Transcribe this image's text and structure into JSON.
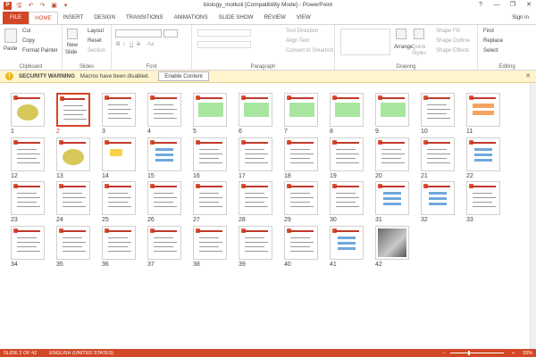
{
  "window": {
    "title": "biology_molkoli [Compatibility Mode] - PowerPoint",
    "controls": [
      "?",
      "—",
      "❐",
      "✕"
    ]
  },
  "qat": {
    "save": "🖫",
    "undo": "↶",
    "redo": "↷",
    "present": "▣",
    "customize": "▾"
  },
  "tabs": [
    "FILE",
    "HOME",
    "INSERT",
    "DESIGN",
    "TRANSITIONS",
    "ANIMATIONS",
    "SLIDE SHOW",
    "REVIEW",
    "VIEW"
  ],
  "active_tab": "HOME",
  "signin": "Sign in",
  "ribbon": {
    "clipboard": {
      "label": "Clipboard",
      "paste": "Paste",
      "cut": "Cut",
      "copy": "Copy",
      "format_painter": "Format Painter"
    },
    "slides": {
      "label": "Slides",
      "new_slide": "New",
      "new_slide2": "Slide",
      "layout": "Layout",
      "reset": "Reset",
      "section": "Section"
    },
    "font": {
      "label": "Font",
      "bold": "B",
      "italic": "I",
      "underline": "U",
      "strike": "S",
      "aa": "Aa"
    },
    "paragraph": {
      "label": "Paragraph",
      "text_direction": "Text Direction",
      "align_text": "Align Text",
      "convert": "Convert to SmartArt"
    },
    "drawing": {
      "label": "Drawing",
      "arrange": "Arrange",
      "quick_styles": "Quick Styles",
      "shape_fill": "Shape Fill",
      "shape_outline": "Shape Outline",
      "shape_effects": "Shape Effects"
    },
    "editing": {
      "label": "Editing",
      "find": "Find",
      "replace": "Replace",
      "select": "Select"
    }
  },
  "security": {
    "title": "SECURITY WARNING",
    "message": "Macros have been disabled.",
    "button": "Enable Content",
    "close": "✕"
  },
  "slides": [
    {
      "n": "1",
      "kind": "title-art"
    },
    {
      "n": "2",
      "kind": "diagram"
    },
    {
      "n": "3",
      "kind": "diagram"
    },
    {
      "n": "4",
      "kind": "diagram"
    },
    {
      "n": "5",
      "kind": "green-text"
    },
    {
      "n": "6",
      "kind": "green-text"
    },
    {
      "n": "7",
      "kind": "green-text"
    },
    {
      "n": "8",
      "kind": "green-text"
    },
    {
      "n": "9",
      "kind": "green-text"
    },
    {
      "n": "10",
      "kind": "text-bullets"
    },
    {
      "n": "11",
      "kind": "orange-boxes"
    },
    {
      "n": "12",
      "kind": "diagram"
    },
    {
      "n": "13",
      "kind": "title-art"
    },
    {
      "n": "14",
      "kind": "yellow-box"
    },
    {
      "n": "15",
      "kind": "blue-list"
    },
    {
      "n": "16",
      "kind": "diagram"
    },
    {
      "n": "17",
      "kind": "text-bullets"
    },
    {
      "n": "18",
      "kind": "diagram"
    },
    {
      "n": "19",
      "kind": "diagram"
    },
    {
      "n": "20",
      "kind": "diagram"
    },
    {
      "n": "21",
      "kind": "text-bullets"
    },
    {
      "n": "22",
      "kind": "blue-list"
    },
    {
      "n": "23",
      "kind": "text-bullets"
    },
    {
      "n": "24",
      "kind": "diagram"
    },
    {
      "n": "25",
      "kind": "text-bullets"
    },
    {
      "n": "26",
      "kind": "diagram"
    },
    {
      "n": "27",
      "kind": "diagram"
    },
    {
      "n": "28",
      "kind": "text-bullets"
    },
    {
      "n": "29",
      "kind": "diagram"
    },
    {
      "n": "30",
      "kind": "text-bullets"
    },
    {
      "n": "31",
      "kind": "blue-list"
    },
    {
      "n": "32",
      "kind": "blue-list"
    },
    {
      "n": "33",
      "kind": "text-bullets"
    },
    {
      "n": "34",
      "kind": "diagram"
    },
    {
      "n": "35",
      "kind": "diagram"
    },
    {
      "n": "36",
      "kind": "diagram"
    },
    {
      "n": "37",
      "kind": "text-bullets"
    },
    {
      "n": "38",
      "kind": "text-bullets"
    },
    {
      "n": "39",
      "kind": "diagram"
    },
    {
      "n": "40",
      "kind": "diagram"
    },
    {
      "n": "41",
      "kind": "blue-list"
    },
    {
      "n": "42",
      "kind": "photo"
    }
  ],
  "selected_slide": "2",
  "status": {
    "slide": "SLIDE 2 OF 42",
    "language": "ENGLISH (UNITED STATES)",
    "zoom": "33%",
    "zoom_fraction": 0.33
  },
  "colors": {
    "accent": "#d24726",
    "warning_bg": "#fff4ce"
  }
}
